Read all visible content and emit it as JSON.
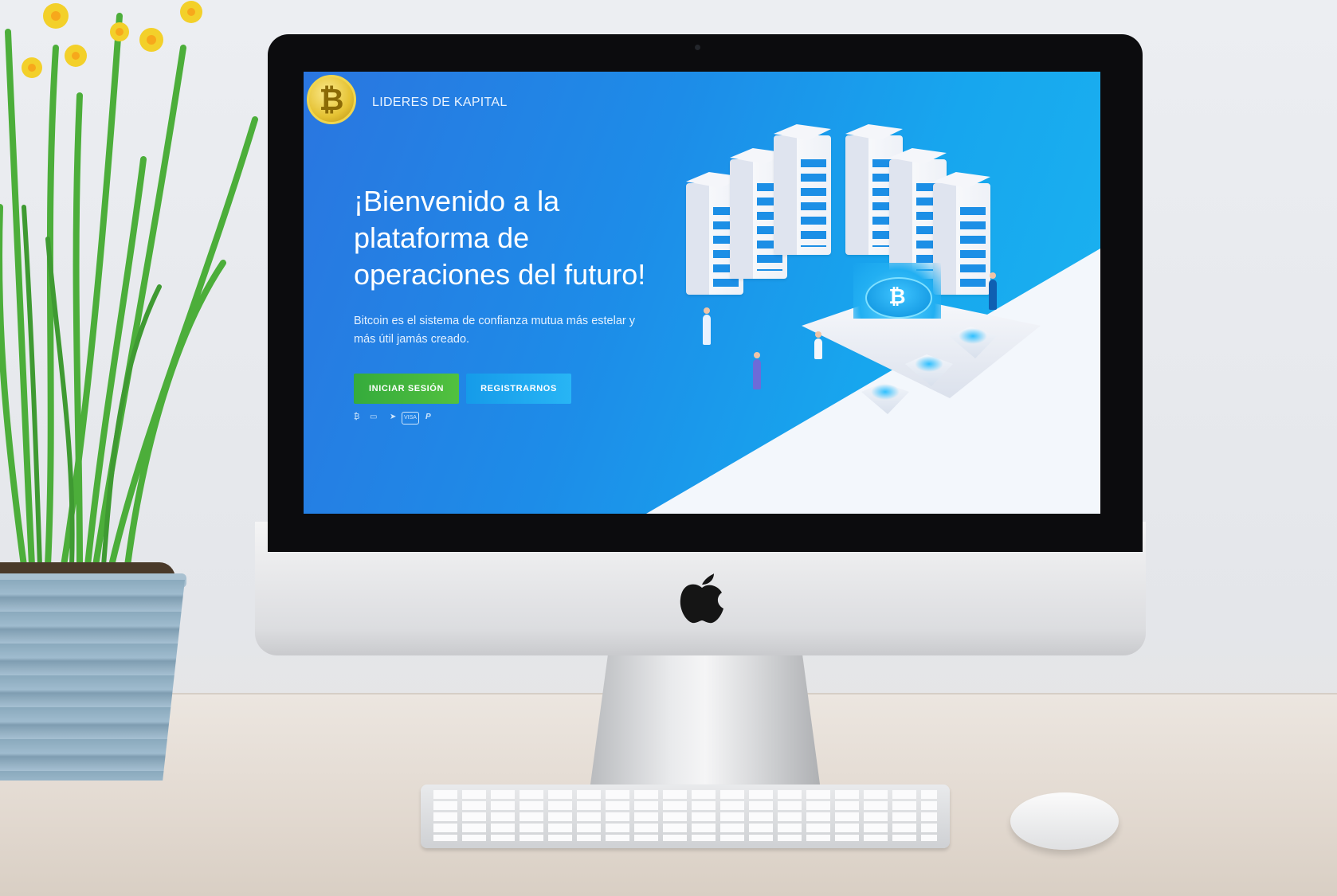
{
  "screen": {
    "brand": {
      "logo_glyph": "₿",
      "logo_icon": "bitcoin-coin-logo",
      "name": "LIDERES DE KAPITAL"
    },
    "hero": {
      "headline_lines": [
        "¡Bienvenido a la",
        "plataforma de",
        "operaciones del futuro!"
      ],
      "subtitle": "Bitcoin es el sistema de confianza mutua más estelar y más útil jamás creado."
    },
    "buttons": {
      "login": "INICIAR SESIÓN",
      "register": "REGISTRARNOS"
    },
    "payment_methods": [
      "bitcoin-icon",
      "cash-icon",
      "telegram-icon",
      "visa-icon",
      "paypal-icon"
    ],
    "payment_labels": {
      "bitcoin": "₿",
      "cash": "▭",
      "telegram": "➤",
      "visa": "VISA",
      "paypal": "P"
    },
    "illustration": {
      "icon": "bitcoin-data-center-illustration",
      "coin_glyph": "₿"
    }
  },
  "device": {
    "logo": "apple-logo",
    "logo_glyph": ""
  },
  "colors": {
    "hero_blue": "#1d8ce8",
    "login_green": "#35ab3c",
    "register_blue": "#159be9",
    "logo_gold": "#e5c233"
  }
}
